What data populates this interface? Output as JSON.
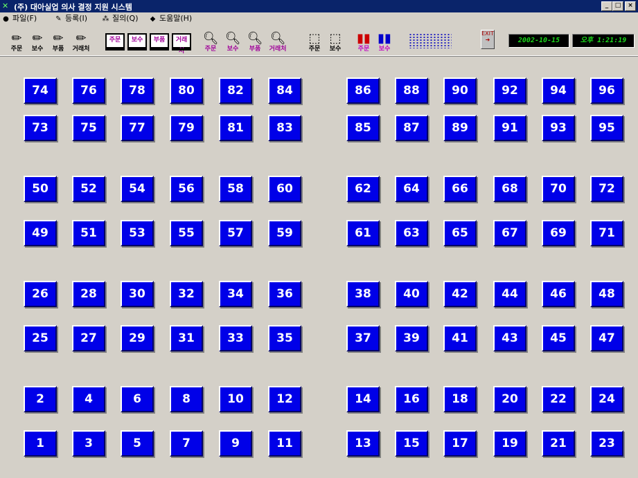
{
  "window": {
    "title": "(주) 대아실업 의사 결정 지원 시스템",
    "controls": {
      "minimize": "_",
      "maximize": "□",
      "close": "×"
    }
  },
  "menu": [
    {
      "label": "파일(F)",
      "icon": "file-icon"
    },
    {
      "label": "등록(I)",
      "icon": "register-icon"
    },
    {
      "label": "질의(Q)",
      "icon": "query-icon"
    },
    {
      "label": "도움말(H)",
      "icon": "help-icon"
    }
  ],
  "toolbar": {
    "pencil_tools": [
      "주문",
      "보수",
      "부품",
      "거래처"
    ],
    "book_tools": [
      "주문",
      "보수",
      "부품",
      "거래처"
    ],
    "search_tools": [
      "주문",
      "보수",
      "부품",
      "거래처"
    ],
    "box_tools": [
      "주문",
      "보수"
    ],
    "chart_tools": [
      "주문",
      "보수"
    ],
    "exit_label": "EXIT",
    "date": "2002-10-15",
    "time": "오후 1:21:19"
  },
  "tables": {
    "rows": [
      [
        "74",
        "76",
        "78",
        "80",
        "82",
        "84",
        "86",
        "88",
        "90",
        "92",
        "94",
        "96"
      ],
      [
        "73",
        "75",
        "77",
        "79",
        "81",
        "83",
        "85",
        "87",
        "89",
        "91",
        "93",
        "95"
      ],
      [
        "50",
        "52",
        "54",
        "56",
        "58",
        "60",
        "62",
        "64",
        "66",
        "68",
        "70",
        "72"
      ],
      [
        "49",
        "51",
        "53",
        "55",
        "57",
        "59",
        "61",
        "63",
        "65",
        "67",
        "69",
        "71"
      ],
      [
        "26",
        "28",
        "30",
        "32",
        "34",
        "36",
        "38",
        "40",
        "42",
        "44",
        "46",
        "48"
      ],
      [
        "25",
        "27",
        "29",
        "31",
        "33",
        "35",
        "37",
        "39",
        "41",
        "43",
        "45",
        "47"
      ],
      [
        "2",
        "4",
        "6",
        "8",
        "10",
        "12",
        "14",
        "16",
        "18",
        "20",
        "22",
        "24"
      ],
      [
        "1",
        "3",
        "5",
        "7",
        "9",
        "11",
        "13",
        "15",
        "17",
        "19",
        "21",
        "23"
      ]
    ]
  },
  "colors": {
    "tile": "#0000e8",
    "background": "#d4d0c8",
    "lcd_text": "#1ad81a"
  }
}
